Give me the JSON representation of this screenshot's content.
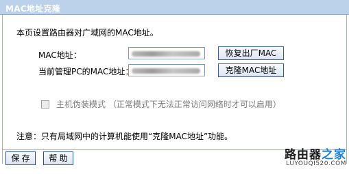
{
  "header": {
    "title": "MAC地址克隆"
  },
  "description": "本页设置路由器对广域网的MAC地址。",
  "form": {
    "mac_label": "MAC地址：",
    "mac_value": "",
    "pc_mac_label": "当前管理PC的MAC地址：",
    "pc_mac_value": ""
  },
  "buttons": {
    "restore": "恢复出厂MAC",
    "clone": "克隆MAC地址",
    "save": "保 存",
    "help": "帮 助"
  },
  "spoof": {
    "label": "主机伪装模式 （正常模式下无法正常访问网络时才可以启用）",
    "checked": false,
    "enabled": false
  },
  "note": "注意：只有局域网中的计算机能使用“克隆MAC地址”功能。",
  "logo": {
    "text_main": "路由器",
    "text_accent": "之家",
    "url": "LUYOUQI520.COM"
  }
}
